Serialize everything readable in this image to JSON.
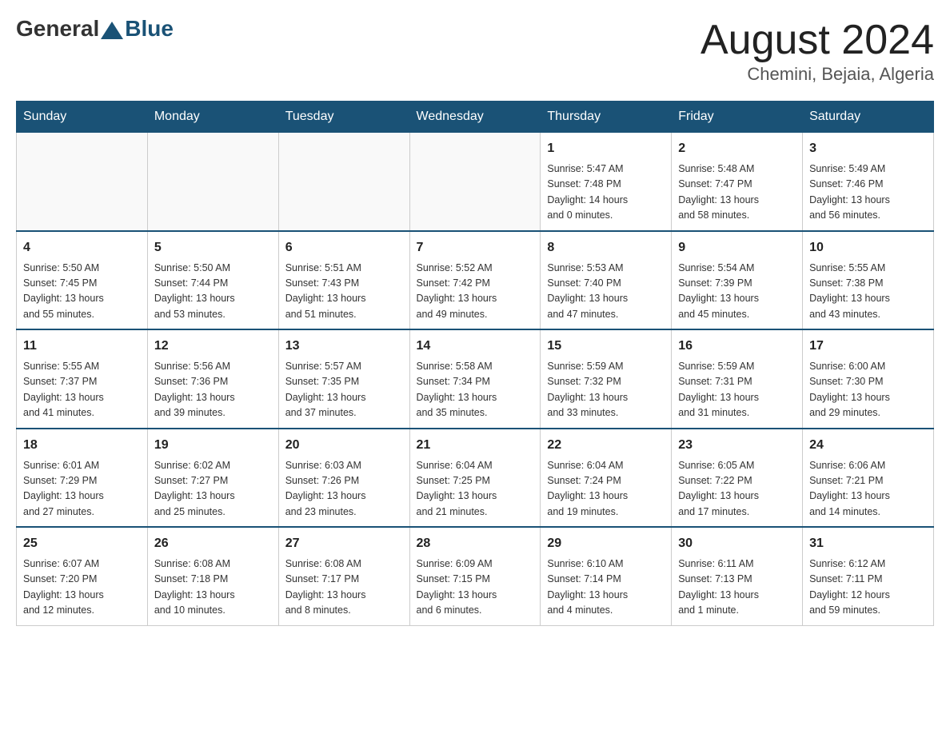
{
  "header": {
    "logo_general": "General",
    "logo_blue": "Blue",
    "main_title": "August 2024",
    "subtitle": "Chemini, Bejaia, Algeria"
  },
  "weekdays": [
    "Sunday",
    "Monday",
    "Tuesday",
    "Wednesday",
    "Thursday",
    "Friday",
    "Saturday"
  ],
  "weeks": [
    [
      {
        "day": "",
        "info": ""
      },
      {
        "day": "",
        "info": ""
      },
      {
        "day": "",
        "info": ""
      },
      {
        "day": "",
        "info": ""
      },
      {
        "day": "1",
        "info": "Sunrise: 5:47 AM\nSunset: 7:48 PM\nDaylight: 14 hours\nand 0 minutes."
      },
      {
        "day": "2",
        "info": "Sunrise: 5:48 AM\nSunset: 7:47 PM\nDaylight: 13 hours\nand 58 minutes."
      },
      {
        "day": "3",
        "info": "Sunrise: 5:49 AM\nSunset: 7:46 PM\nDaylight: 13 hours\nand 56 minutes."
      }
    ],
    [
      {
        "day": "4",
        "info": "Sunrise: 5:50 AM\nSunset: 7:45 PM\nDaylight: 13 hours\nand 55 minutes."
      },
      {
        "day": "5",
        "info": "Sunrise: 5:50 AM\nSunset: 7:44 PM\nDaylight: 13 hours\nand 53 minutes."
      },
      {
        "day": "6",
        "info": "Sunrise: 5:51 AM\nSunset: 7:43 PM\nDaylight: 13 hours\nand 51 minutes."
      },
      {
        "day": "7",
        "info": "Sunrise: 5:52 AM\nSunset: 7:42 PM\nDaylight: 13 hours\nand 49 minutes."
      },
      {
        "day": "8",
        "info": "Sunrise: 5:53 AM\nSunset: 7:40 PM\nDaylight: 13 hours\nand 47 minutes."
      },
      {
        "day": "9",
        "info": "Sunrise: 5:54 AM\nSunset: 7:39 PM\nDaylight: 13 hours\nand 45 minutes."
      },
      {
        "day": "10",
        "info": "Sunrise: 5:55 AM\nSunset: 7:38 PM\nDaylight: 13 hours\nand 43 minutes."
      }
    ],
    [
      {
        "day": "11",
        "info": "Sunrise: 5:55 AM\nSunset: 7:37 PM\nDaylight: 13 hours\nand 41 minutes."
      },
      {
        "day": "12",
        "info": "Sunrise: 5:56 AM\nSunset: 7:36 PM\nDaylight: 13 hours\nand 39 minutes."
      },
      {
        "day": "13",
        "info": "Sunrise: 5:57 AM\nSunset: 7:35 PM\nDaylight: 13 hours\nand 37 minutes."
      },
      {
        "day": "14",
        "info": "Sunrise: 5:58 AM\nSunset: 7:34 PM\nDaylight: 13 hours\nand 35 minutes."
      },
      {
        "day": "15",
        "info": "Sunrise: 5:59 AM\nSunset: 7:32 PM\nDaylight: 13 hours\nand 33 minutes."
      },
      {
        "day": "16",
        "info": "Sunrise: 5:59 AM\nSunset: 7:31 PM\nDaylight: 13 hours\nand 31 minutes."
      },
      {
        "day": "17",
        "info": "Sunrise: 6:00 AM\nSunset: 7:30 PM\nDaylight: 13 hours\nand 29 minutes."
      }
    ],
    [
      {
        "day": "18",
        "info": "Sunrise: 6:01 AM\nSunset: 7:29 PM\nDaylight: 13 hours\nand 27 minutes."
      },
      {
        "day": "19",
        "info": "Sunrise: 6:02 AM\nSunset: 7:27 PM\nDaylight: 13 hours\nand 25 minutes."
      },
      {
        "day": "20",
        "info": "Sunrise: 6:03 AM\nSunset: 7:26 PM\nDaylight: 13 hours\nand 23 minutes."
      },
      {
        "day": "21",
        "info": "Sunrise: 6:04 AM\nSunset: 7:25 PM\nDaylight: 13 hours\nand 21 minutes."
      },
      {
        "day": "22",
        "info": "Sunrise: 6:04 AM\nSunset: 7:24 PM\nDaylight: 13 hours\nand 19 minutes."
      },
      {
        "day": "23",
        "info": "Sunrise: 6:05 AM\nSunset: 7:22 PM\nDaylight: 13 hours\nand 17 minutes."
      },
      {
        "day": "24",
        "info": "Sunrise: 6:06 AM\nSunset: 7:21 PM\nDaylight: 13 hours\nand 14 minutes."
      }
    ],
    [
      {
        "day": "25",
        "info": "Sunrise: 6:07 AM\nSunset: 7:20 PM\nDaylight: 13 hours\nand 12 minutes."
      },
      {
        "day": "26",
        "info": "Sunrise: 6:08 AM\nSunset: 7:18 PM\nDaylight: 13 hours\nand 10 minutes."
      },
      {
        "day": "27",
        "info": "Sunrise: 6:08 AM\nSunset: 7:17 PM\nDaylight: 13 hours\nand 8 minutes."
      },
      {
        "day": "28",
        "info": "Sunrise: 6:09 AM\nSunset: 7:15 PM\nDaylight: 13 hours\nand 6 minutes."
      },
      {
        "day": "29",
        "info": "Sunrise: 6:10 AM\nSunset: 7:14 PM\nDaylight: 13 hours\nand 4 minutes."
      },
      {
        "day": "30",
        "info": "Sunrise: 6:11 AM\nSunset: 7:13 PM\nDaylight: 13 hours\nand 1 minute."
      },
      {
        "day": "31",
        "info": "Sunrise: 6:12 AM\nSunset: 7:11 PM\nDaylight: 12 hours\nand 59 minutes."
      }
    ]
  ]
}
